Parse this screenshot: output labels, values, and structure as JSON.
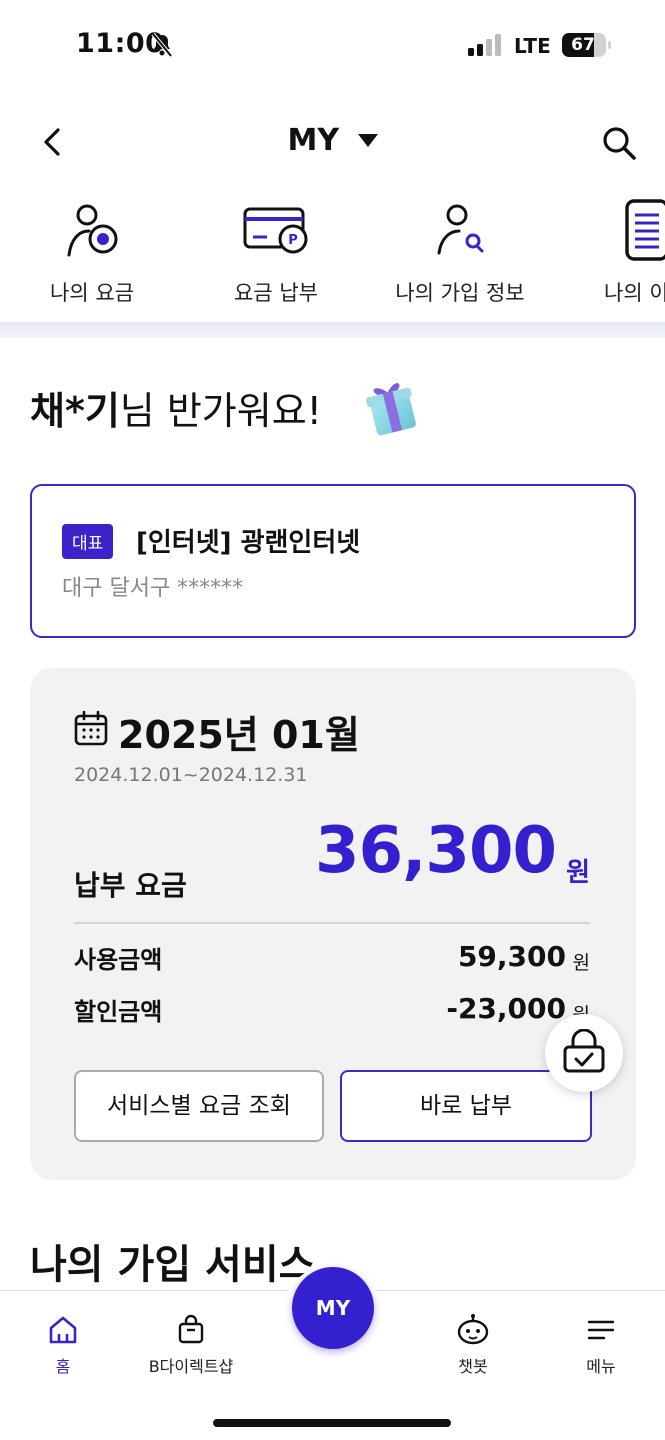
{
  "status_bar": {
    "time": "11:00",
    "network": "LTE",
    "battery": "67"
  },
  "header": {
    "title": "MY"
  },
  "quick_menu": [
    {
      "label": "나의 요금",
      "icon": "user-fee-icon"
    },
    {
      "label": "요금 납부",
      "icon": "card-payment-icon"
    },
    {
      "label": "나의 가입 정보",
      "icon": "user-search-icon"
    },
    {
      "label": "나의 이용",
      "icon": "document-list-icon"
    }
  ],
  "greeting": {
    "name": "채*기",
    "message": "님 반가워요!"
  },
  "account": {
    "badge": "대표",
    "title": "[인터넷] 광랜인터넷",
    "address": "대구 달서구 ******"
  },
  "bill": {
    "month": "2025년 01월",
    "period": "2024.12.01~2024.12.31",
    "pay_label": "납부 요금",
    "pay_amount": "36,300",
    "unit": "원",
    "usage_label": "사용금액",
    "usage_amount": "59,300",
    "discount_label": "할인금액",
    "discount_amount": "-23,000",
    "service_button": "서비스별 요금 조회",
    "pay_button": "바로 납부"
  },
  "section": {
    "title": "나의 가입 서비스"
  },
  "bottom_nav": {
    "home": "홈",
    "shop": "B다이렉트샵",
    "center": "MY",
    "chatbot": "챗봇",
    "menu": "메뉴"
  },
  "colors": {
    "primary": "#3420cf",
    "border_primary": "#3a2bc4",
    "card_bg": "#f2f2f3"
  }
}
